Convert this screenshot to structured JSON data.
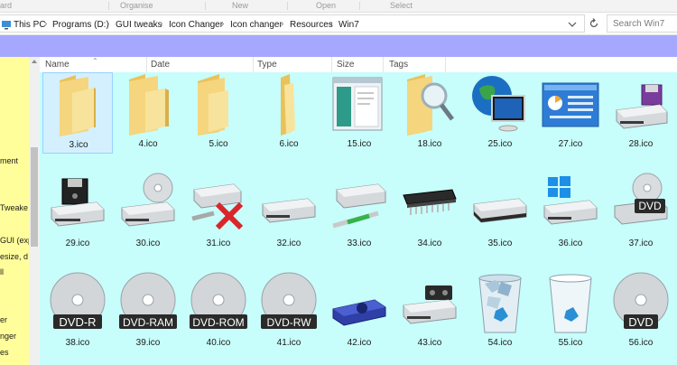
{
  "ribbon": {
    "tabs": [
      "ard",
      "Organise",
      "New",
      "Open",
      "Select"
    ]
  },
  "address": {
    "crumbs": [
      "This PC",
      "Programs (D:)",
      "GUI tweaks",
      "Icon Changer",
      "Icon changer",
      "Resources",
      "Win7"
    ],
    "search_placeholder": "Search Win7"
  },
  "navpane": {
    "items": [
      "ment",
      "Tweake",
      "GUI (exp",
      "esize, d",
      "ll",
      "er",
      "nger",
      "es"
    ]
  },
  "columns": [
    "Name",
    "Date",
    "Type",
    "Size",
    "Tags"
  ],
  "files": [
    {
      "name": "3.ico",
      "icon": "folder-icon"
    },
    {
      "name": "4.ico",
      "icon": "folder-icon"
    },
    {
      "name": "5.ico",
      "icon": "folder-icon"
    },
    {
      "name": "6.ico",
      "icon": "folder-narrow-icon"
    },
    {
      "name": "15.ico",
      "icon": "window-icon"
    },
    {
      "name": "18.ico",
      "icon": "folder-search-icon"
    },
    {
      "name": "25.ico",
      "icon": "globe-monitor-icon"
    },
    {
      "name": "27.ico",
      "icon": "control-panel-icon"
    },
    {
      "name": "28.ico",
      "icon": "floppy-drive-icon"
    },
    {
      "name": "29.ico",
      "icon": "floppy-drive-icon"
    },
    {
      "name": "30.ico",
      "icon": "cd-drive-icon"
    },
    {
      "name": "31.ico",
      "icon": "network-drive-disconnected-icon"
    },
    {
      "name": "32.ico",
      "icon": "hard-drive-icon"
    },
    {
      "name": "33.ico",
      "icon": "network-drive-icon"
    },
    {
      "name": "34.ico",
      "icon": "chip-icon"
    },
    {
      "name": "35.ico",
      "icon": "dark-drive-icon"
    },
    {
      "name": "36.ico",
      "icon": "windows-drive-icon"
    },
    {
      "name": "37.ico",
      "icon": "dvd-drive-icon"
    },
    {
      "name": "38.ico",
      "icon": "dvd-r-icon"
    },
    {
      "name": "39.ico",
      "icon": "dvd-ram-icon"
    },
    {
      "name": "40.ico",
      "icon": "dvd-rom-icon"
    },
    {
      "name": "41.ico",
      "icon": "dvd-rw-icon"
    },
    {
      "name": "42.ico",
      "icon": "blue-drive-icon"
    },
    {
      "name": "43.ico",
      "icon": "tape-drive-icon"
    },
    {
      "name": "54.ico",
      "icon": "recycle-bin-full-icon"
    },
    {
      "name": "55.ico",
      "icon": "recycle-bin-empty-icon"
    },
    {
      "name": "56.ico",
      "icon": "dvd-icon"
    }
  ],
  "disc_labels": {
    "dvd": "DVD",
    "dvd_r": "DVD-R",
    "dvd_ram": "DVD-RAM",
    "dvd_rom": "DVD-ROM",
    "dvd_rw": "DVD-RW"
  },
  "colors": {
    "content_bg": "#c7fdfa",
    "band": "#a6a8ff",
    "navpane": "#fffe9a",
    "folder": "#f5d57e"
  }
}
